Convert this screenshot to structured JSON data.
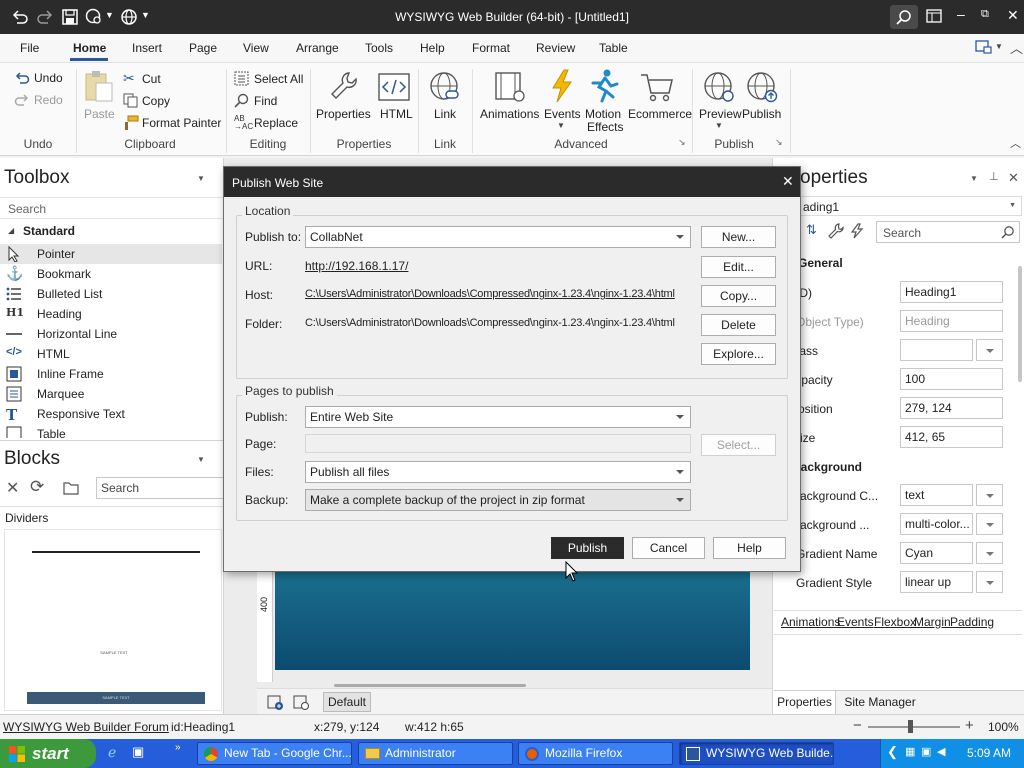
{
  "window": {
    "title": "WYSIWYG Web Builder (64-bit) - [Untitled1]"
  },
  "menu": [
    "File",
    "Home",
    "Insert",
    "Page",
    "View",
    "Arrange",
    "Tools",
    "Help",
    "Format",
    "Review",
    "Table"
  ],
  "ribbon": {
    "undo": "Undo",
    "redo": "Redo",
    "paste": "Paste",
    "cut": "Cut",
    "copy": "Copy",
    "format_painter": "Format Painter",
    "select_all": "Select All",
    "find": "Find",
    "replace": "Replace",
    "properties": "Properties",
    "html": "HTML",
    "link": "Link",
    "animations": "Animations",
    "events": "Events",
    "motion_effects_1": "Motion",
    "motion_effects_2": "Effects",
    "ecommerce": "Ecommerce",
    "preview": "Preview",
    "publish": "Publish",
    "groups": {
      "undo": "Undo",
      "clipboard": "Clipboard",
      "editing": "Editing",
      "properties": "Properties",
      "link": "Link",
      "advanced": "Advanced",
      "publish": "Publish"
    }
  },
  "toolbox": {
    "title": "Toolbox",
    "search_placeholder": "Search",
    "section": "Standard",
    "items": [
      "Pointer",
      "Bookmark",
      "Bulleted List",
      "Heading",
      "Horizontal Line",
      "HTML",
      "Inline Frame",
      "Marquee",
      "Responsive Text",
      "Table"
    ]
  },
  "blocks": {
    "title": "Blocks",
    "search_placeholder": "Search",
    "category": "Dividers",
    "preview_text_1": "SAMPLE TEXT",
    "preview_text_2": "SAMPLE TEXT"
  },
  "canvas": {
    "ruler_label": "400",
    "tab_label": "Default"
  },
  "properties": {
    "title": "operties",
    "object": "ading1",
    "search_placeholder": "Search",
    "section_general": "General",
    "rows": [
      {
        "label": "(ID)",
        "value": "Heading1"
      },
      {
        "label": "(Object Type)",
        "value": "Heading"
      },
      {
        "label": "Class",
        "value": ""
      },
      {
        "label": "Opacity",
        "value": "100"
      },
      {
        "label": "Position",
        "value": "279, 124"
      },
      {
        "label": "Size",
        "value": "412, 65"
      }
    ],
    "section_background": "Background",
    "bg_rows": [
      {
        "label": "Background C...",
        "value": "text"
      },
      {
        "label": "Background ...",
        "value": "multi-color..."
      },
      {
        "label": "Gradient Name",
        "value": "Cyan"
      },
      {
        "label": "Gradient Style",
        "value": "linear up"
      }
    ],
    "links": [
      "Animations",
      "Events",
      "Flexbox",
      "Margin",
      "Padding"
    ],
    "tabs": [
      "Properties",
      "Site Manager"
    ]
  },
  "dialog": {
    "title": "Publish Web Site",
    "location_title": "Location",
    "publish_to_label": "Publish to:",
    "publish_to_value": "CollabNet",
    "url_label": "URL:",
    "url_value": "http://192.168.1.17/",
    "host_label": "Host:",
    "host_value": "C:\\Users\\Administrator\\Downloads\\Compressed\\nginx-1.23.4\\nginx-1.23.4\\html",
    "folder_label": "Folder:",
    "folder_value": "C:\\Users\\Administrator\\Downloads\\Compressed\\nginx-1.23.4\\nginx-1.23.4\\html",
    "new_btn": "New...",
    "edit_btn": "Edit...",
    "copy_btn": "Copy...",
    "delete_btn": "Delete",
    "explore_btn": "Explore...",
    "pages_title": "Pages to publish",
    "publish_label": "Publish:",
    "publish_value": "Entire Web Site",
    "page_label": "Page:",
    "page_value": "",
    "select_btn": "Select...",
    "files_label": "Files:",
    "files_value": "Publish all files",
    "backup_label": "Backup:",
    "backup_value": "Make a complete backup of the project in zip format",
    "publish_btn": "Publish",
    "cancel_btn": "Cancel",
    "help_btn": "Help"
  },
  "statusbar": {
    "forum": "WYSIWYG Web Builder Forum",
    "id": "id:Heading1",
    "coords": "x:279, y:124",
    "size": "w:412 h:65",
    "zoom": "100%"
  },
  "taskbar": {
    "start": "start",
    "buttons": [
      "New Tab - Google Chr...",
      "Administrator",
      "Mozilla Firefox",
      "WYSIWYG Web Builde..."
    ],
    "clock": "5:09 AM"
  },
  "colors": {
    "accent": "#2b579a",
    "dark": "#2b2b2b",
    "taskbar": "#245edb",
    "start": "#3c9a3c",
    "canvas_gradient_top": "#1a6f8e",
    "canvas_gradient_bottom": "#0d4a70"
  }
}
